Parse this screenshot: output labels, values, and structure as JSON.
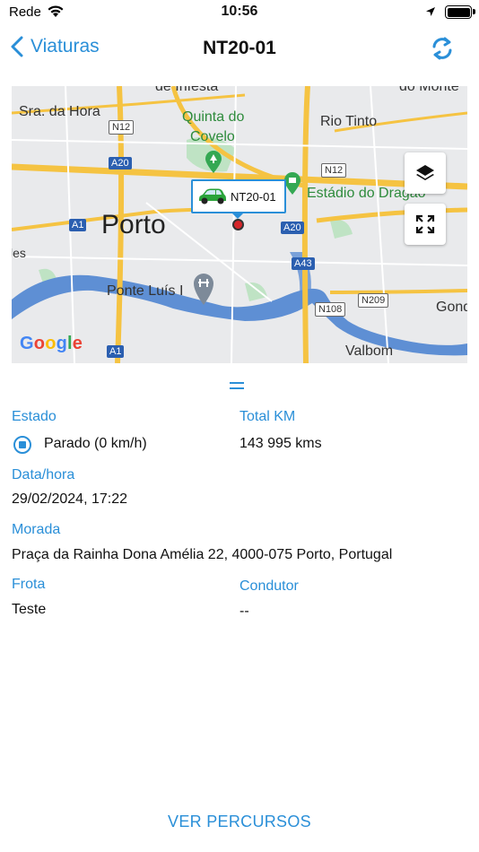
{
  "status_bar": {
    "carrier": "Rede",
    "time": "10:56"
  },
  "nav": {
    "back_label": "Viaturas",
    "title": "NT20-01"
  },
  "map": {
    "labels": {
      "place_1": "de Infesta",
      "place_2": "Sra. da Hora",
      "place_3": "Quinta do",
      "place_3b": "Covelo",
      "place_4": "Rio Tinto",
      "place_5": "do Monte",
      "place_6": "Estádio do Dragão",
      "place_7": "Porto",
      "place_8": "Ponte Luís I",
      "place_9": "Valbom",
      "place_10": "Gond",
      "place_11": "les"
    },
    "roads": {
      "n12_a": "N12",
      "n12_b": "N12",
      "a20_a": "A20",
      "a20_b": "A20",
      "a1_a": "A1",
      "a1_b": "A1",
      "a43": "A43",
      "n209": "N209",
      "n108": "N108"
    },
    "vehicle_label": "NT20-01",
    "google": "Google",
    "colors": {
      "land": "#e9eaec",
      "water": "#5e8fd4",
      "road": "#f5c342",
      "park": "#bfe3c4",
      "marker": "#d5262a"
    }
  },
  "details": {
    "estado_label": "Estado",
    "estado_value": "Parado (0 km/h)",
    "total_km_label": "Total KM",
    "total_km_value": "143 995 kms",
    "datahora_label": "Data/hora",
    "datahora_value": "29/02/2024, 17:22",
    "morada_label": "Morada",
    "morada_value": "Praça da Rainha Dona Amélia 22, 4000-075 Porto, Portugal",
    "frota_label": "Frota",
    "frota_value": "Teste",
    "condutor_label": "Condutor",
    "condutor_value": "--"
  },
  "actions": {
    "routes_label": "VER PERCURSOS"
  },
  "icons": [
    "wifi-icon",
    "location-arrow-icon",
    "battery-icon",
    "chevron-left-icon",
    "refresh-icon",
    "layers-icon",
    "fullscreen-icon",
    "car-icon",
    "stop-circle-icon",
    "drag-handle-icon"
  ],
  "accent_color": "#2a8fd8"
}
